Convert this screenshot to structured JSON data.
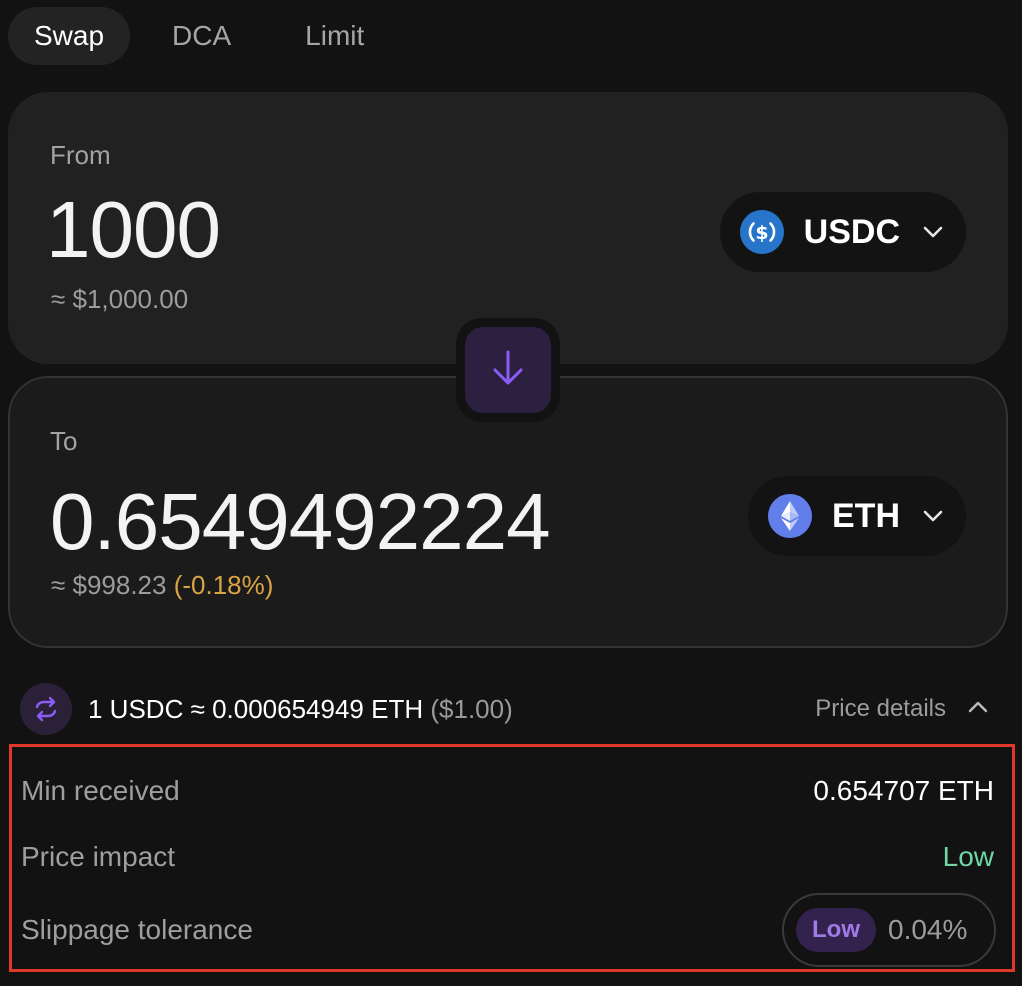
{
  "tabs": [
    {
      "label": "Swap",
      "active": true
    },
    {
      "label": "DCA",
      "active": false
    },
    {
      "label": "Limit",
      "active": false
    }
  ],
  "from": {
    "label": "From",
    "amount": "1000",
    "usd_value": "≈ $1,000.00",
    "token": {
      "symbol": "USDC",
      "icon": "usdc-icon",
      "color": "#2775ca"
    }
  },
  "to": {
    "label": "To",
    "amount": "0.6549492224",
    "usd_value": "≈ $998.23",
    "usd_change": "(-0.18%)",
    "token": {
      "symbol": "ETH",
      "icon": "eth-icon",
      "color": "#627eea"
    }
  },
  "rate": {
    "text": "1 USDC ≈ 0.000654949 ETH",
    "usd": "($1.00)",
    "details_label": "Price details"
  },
  "details": {
    "min_received": {
      "label": "Min received",
      "value": "0.654707 ETH"
    },
    "price_impact": {
      "label": "Price impact",
      "value": "Low"
    },
    "slippage": {
      "label": "Slippage tolerance",
      "badge": "Low",
      "value": "0.04%"
    }
  },
  "colors": {
    "accent": "#8b5cf6",
    "warning": "#d9a443",
    "success": "#6fd6a6",
    "highlight_border": "#e0392b"
  }
}
